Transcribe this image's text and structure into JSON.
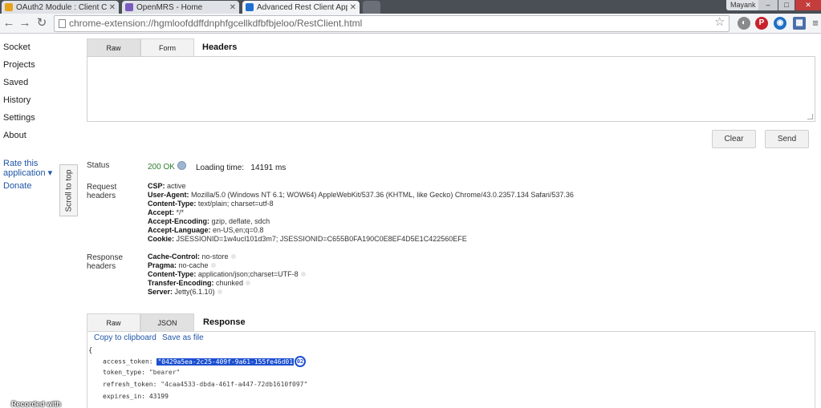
{
  "browser": {
    "tabs": [
      {
        "label": "OAuth2 Module : Client C",
        "favicon_color": "#e7a21b",
        "active": false
      },
      {
        "label": "OpenMRS - Home",
        "favicon_color": "#7a5bbf",
        "active": false
      },
      {
        "label": "Advanced Rest Client App",
        "favicon_color": "#1f6fd1",
        "active": true
      }
    ],
    "profile_name": "Mayank",
    "window_controls": [
      "–",
      "□",
      "✕"
    ],
    "url": "chrome-extension://hgmloofddffdnphfgcellkdfbfbjeloo/RestClient.html",
    "extension_icons": [
      {
        "icon": "circle-gray-icon",
        "color": "#8a8a8a",
        "glyph": "◐"
      },
      {
        "icon": "pinterest-icon",
        "color": "#c8232c",
        "glyph": "P"
      },
      {
        "icon": "globe-icon",
        "color": "#1d6fc4",
        "glyph": "◉"
      },
      {
        "icon": "grid-extension-icon",
        "color": "#4a6ea8",
        "glyph": "▦"
      }
    ]
  },
  "sidebar": {
    "items": [
      "Socket",
      "Projects",
      "Saved",
      "History",
      "Settings",
      "About"
    ],
    "rate_label": "Rate this application ▾",
    "rate_line1": "Rate this",
    "rate_line2": "application ▾",
    "donate_label": "Donate",
    "scroll_to_top": "Scroll to top"
  },
  "request": {
    "tabs": [
      "Raw",
      "Form"
    ],
    "selected_tab": "Raw",
    "section_label": "Headers",
    "textarea_value": "",
    "clear_label": "Clear",
    "send_label": "Send"
  },
  "status": {
    "label": "Status",
    "code": "200 OK",
    "loading_label": "Loading time:",
    "loading_value": "14191 ms"
  },
  "request_headers": {
    "label_line1": "Request",
    "label_line2": "headers",
    "items": [
      {
        "name": "CSP:",
        "value": "active"
      },
      {
        "name": "User-Agent:",
        "value": "Mozilla/5.0 (Windows NT 6.1; WOW64) AppleWebKit/537.36 (KHTML, like Gecko) Chrome/43.0.2357.134 Safari/537.36"
      },
      {
        "name": "Content-Type:",
        "value": "text/plain; charset=utf-8"
      },
      {
        "name": "Accept:",
        "value": "*/*"
      },
      {
        "name": "Accept-Encoding:",
        "value": "gzip, deflate, sdch"
      },
      {
        "name": "Accept-Language:",
        "value": "en-US,en;q=0.8"
      },
      {
        "name": "Cookie:",
        "value": "JSESSIONID=1w4ucl101d3m7; JSESSIONID=C655B0FA190C0E8EF4D5E1C422560EFE"
      }
    ]
  },
  "response_headers": {
    "label_line1": "Response",
    "label_line2": "headers",
    "items": [
      {
        "name": "Cache-Control:",
        "value": "no-store"
      },
      {
        "name": "Pragma:",
        "value": "no-cache"
      },
      {
        "name": "Content-Type:",
        "value": "application/json;charset=UTF-8"
      },
      {
        "name": "Transfer-Encoding:",
        "value": "chunked"
      },
      {
        "name": "Server:",
        "value": "Jetty(6.1.10)"
      }
    ]
  },
  "response": {
    "tabs": [
      "Raw",
      "JSON"
    ],
    "selected_tab": "JSON",
    "section_label": "Response",
    "copy_label": "Copy to clipboard",
    "save_label": "Save as file",
    "json_open": "{",
    "fields": [
      {
        "key": "access_token:",
        "value": "\"0429a5ea-2c25-409f-9a61-155fe46d01",
        "highlighted": true
      },
      {
        "key": "token_type:",
        "value": "\"bearer\"",
        "highlighted": false
      },
      {
        "key": "refresh_token:",
        "value": "\"4caa4533-dbda-461f-a447-72db1610f097\"",
        "highlighted": false
      },
      {
        "key": "expires_in:",
        "value": "43199",
        "highlighted": false
      }
    ],
    "highlight_badge": "02"
  },
  "overlay": {
    "recorded_with": "Recorded with"
  }
}
